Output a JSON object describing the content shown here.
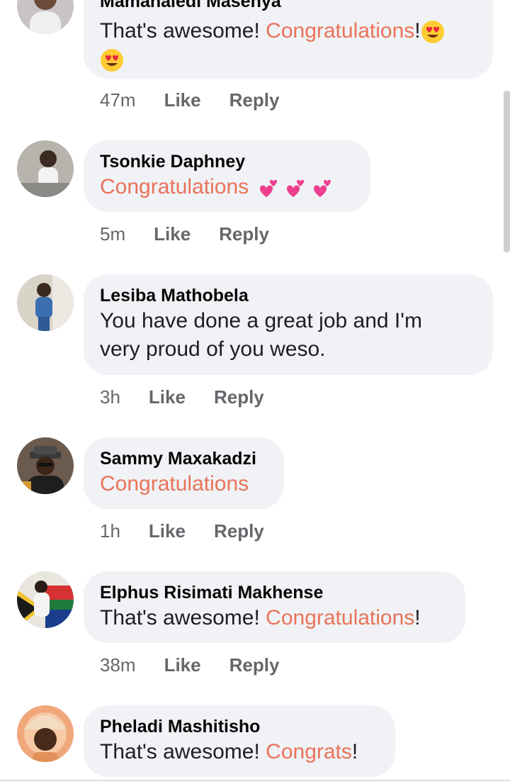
{
  "comments": [
    {
      "name": "Mamahaledi Masenya",
      "text_before": "That's awesome! ",
      "highlight": "Congratulations",
      "text_after": "!",
      "emojis": [
        "heart-eyes-emoji",
        "heart-eyes-emoji"
      ],
      "time": "47m",
      "like": "Like",
      "reply": "Reply"
    },
    {
      "name": "Tsonkie Daphney",
      "highlight": "Congratulations",
      "emojis": [
        "two-hearts-emoji",
        "two-hearts-emoji",
        "two-hearts-emoji"
      ],
      "time": "5m",
      "like": "Like",
      "reply": "Reply"
    },
    {
      "name": "Lesiba Mathobela",
      "line1": "You have done a great job and I'm",
      "line2": "very proud of you weso.",
      "time": "3h",
      "like": "Like",
      "reply": "Reply"
    },
    {
      "name": "Sammy Maxakadzi",
      "highlight": "Congratulations",
      "time": "1h",
      "like": "Like",
      "reply": "Reply"
    },
    {
      "name": "Elphus Risimati Makhense",
      "text_before": "That's awesome! ",
      "highlight": "Congratulations",
      "text_after": "!",
      "time": "38m",
      "like": "Like",
      "reply": "Reply"
    },
    {
      "name": "Pheladi Mashitisho",
      "text_before": "That's awesome! ",
      "highlight": "Congrats",
      "text_after": "!"
    }
  ],
  "colors": {
    "highlight": "#e9735a",
    "bubble": "#f0f2f5",
    "meta": "#65676b"
  }
}
